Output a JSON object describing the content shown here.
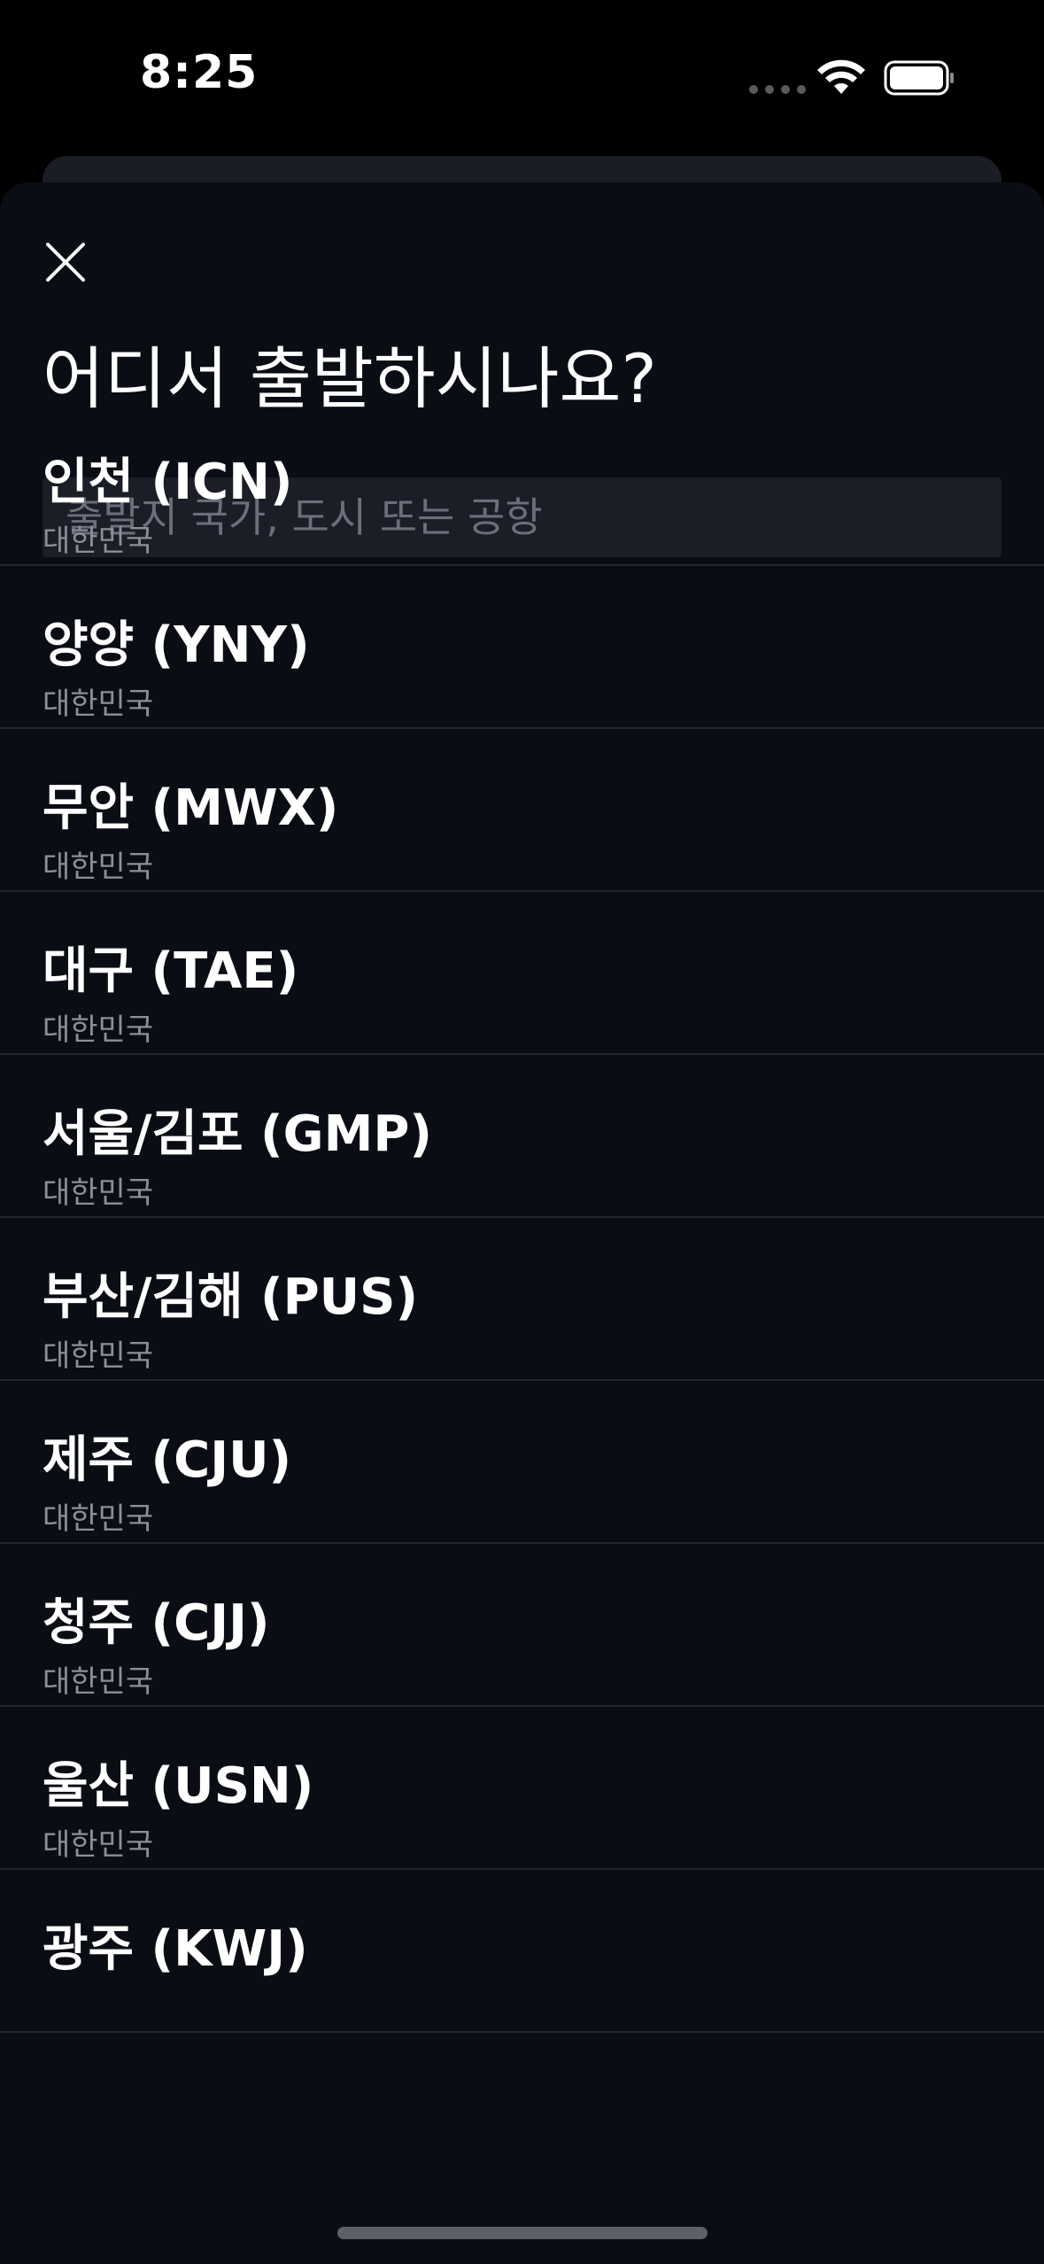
{
  "status_bar": {
    "time": "8:25"
  },
  "header": {
    "title": "어디서 출발하시나요?",
    "close_icon": "close-icon"
  },
  "search": {
    "placeholder": "출발지 국가, 도시 또는 공항",
    "value": ""
  },
  "airports": [
    {
      "name": "인천 (ICN)",
      "country": "대한민국"
    },
    {
      "name": "양양 (YNY)",
      "country": "대한민국"
    },
    {
      "name": "무안 (MWX)",
      "country": "대한민국"
    },
    {
      "name": "대구 (TAE)",
      "country": "대한민국"
    },
    {
      "name": "서울/김포 (GMP)",
      "country": "대한민국"
    },
    {
      "name": "부산/김해 (PUS)",
      "country": "대한민국"
    },
    {
      "name": "제주 (CJU)",
      "country": "대한민국"
    },
    {
      "name": "청주 (CJJ)",
      "country": "대한민국"
    },
    {
      "name": "울산 (USN)",
      "country": "대한민국"
    },
    {
      "name": "광주 (KWJ)",
      "country": ""
    }
  ],
  "colors": {
    "background": "#000000",
    "sheet": "#0a0d14",
    "search_bg": "#1b1e27",
    "divider": "#22252d",
    "secondary_text": "#8b8f98"
  }
}
